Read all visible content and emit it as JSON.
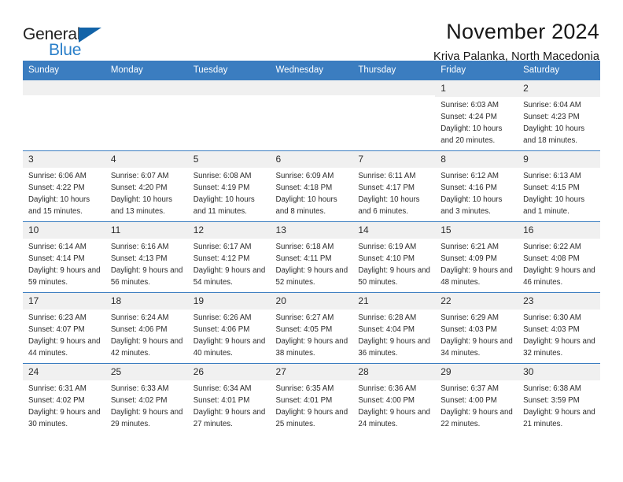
{
  "brand": {
    "name_part1": "General",
    "name_part2": "Blue",
    "triangle_color": "#1263a8",
    "blue_color": "#2a7fc9"
  },
  "header": {
    "title": "November 2024",
    "subtitle": "Kriva Palanka, North Macedonia"
  },
  "theme": {
    "header_bg": "#3b7dc0",
    "header_text": "#ffffff",
    "daynum_bg": "#f0f0f0",
    "cell_bg": "#ffffff",
    "grid_line": "#3b7dc0"
  },
  "calendar": {
    "weekday_headers": [
      "Sunday",
      "Monday",
      "Tuesday",
      "Wednesday",
      "Thursday",
      "Friday",
      "Saturday"
    ],
    "weeks": [
      [
        {
          "day": "",
          "blank": true,
          "sunrise": "",
          "sunset": "",
          "daylight": ""
        },
        {
          "day": "",
          "blank": true,
          "sunrise": "",
          "sunset": "",
          "daylight": ""
        },
        {
          "day": "",
          "blank": true,
          "sunrise": "",
          "sunset": "",
          "daylight": ""
        },
        {
          "day": "",
          "blank": true,
          "sunrise": "",
          "sunset": "",
          "daylight": ""
        },
        {
          "day": "",
          "blank": true,
          "sunrise": "",
          "sunset": "",
          "daylight": ""
        },
        {
          "day": "1",
          "blank": false,
          "sunrise": "Sunrise: 6:03 AM",
          "sunset": "Sunset: 4:24 PM",
          "daylight": "Daylight: 10 hours and 20 minutes."
        },
        {
          "day": "2",
          "blank": false,
          "sunrise": "Sunrise: 6:04 AM",
          "sunset": "Sunset: 4:23 PM",
          "daylight": "Daylight: 10 hours and 18 minutes."
        }
      ],
      [
        {
          "day": "3",
          "blank": false,
          "sunrise": "Sunrise: 6:06 AM",
          "sunset": "Sunset: 4:22 PM",
          "daylight": "Daylight: 10 hours and 15 minutes."
        },
        {
          "day": "4",
          "blank": false,
          "sunrise": "Sunrise: 6:07 AM",
          "sunset": "Sunset: 4:20 PM",
          "daylight": "Daylight: 10 hours and 13 minutes."
        },
        {
          "day": "5",
          "blank": false,
          "sunrise": "Sunrise: 6:08 AM",
          "sunset": "Sunset: 4:19 PM",
          "daylight": "Daylight: 10 hours and 11 minutes."
        },
        {
          "day": "6",
          "blank": false,
          "sunrise": "Sunrise: 6:09 AM",
          "sunset": "Sunset: 4:18 PM",
          "daylight": "Daylight: 10 hours and 8 minutes."
        },
        {
          "day": "7",
          "blank": false,
          "sunrise": "Sunrise: 6:11 AM",
          "sunset": "Sunset: 4:17 PM",
          "daylight": "Daylight: 10 hours and 6 minutes."
        },
        {
          "day": "8",
          "blank": false,
          "sunrise": "Sunrise: 6:12 AM",
          "sunset": "Sunset: 4:16 PM",
          "daylight": "Daylight: 10 hours and 3 minutes."
        },
        {
          "day": "9",
          "blank": false,
          "sunrise": "Sunrise: 6:13 AM",
          "sunset": "Sunset: 4:15 PM",
          "daylight": "Daylight: 10 hours and 1 minute."
        }
      ],
      [
        {
          "day": "10",
          "blank": false,
          "sunrise": "Sunrise: 6:14 AM",
          "sunset": "Sunset: 4:14 PM",
          "daylight": "Daylight: 9 hours and 59 minutes."
        },
        {
          "day": "11",
          "blank": false,
          "sunrise": "Sunrise: 6:16 AM",
          "sunset": "Sunset: 4:13 PM",
          "daylight": "Daylight: 9 hours and 56 minutes."
        },
        {
          "day": "12",
          "blank": false,
          "sunrise": "Sunrise: 6:17 AM",
          "sunset": "Sunset: 4:12 PM",
          "daylight": "Daylight: 9 hours and 54 minutes."
        },
        {
          "day": "13",
          "blank": false,
          "sunrise": "Sunrise: 6:18 AM",
          "sunset": "Sunset: 4:11 PM",
          "daylight": "Daylight: 9 hours and 52 minutes."
        },
        {
          "day": "14",
          "blank": false,
          "sunrise": "Sunrise: 6:19 AM",
          "sunset": "Sunset: 4:10 PM",
          "daylight": "Daylight: 9 hours and 50 minutes."
        },
        {
          "day": "15",
          "blank": false,
          "sunrise": "Sunrise: 6:21 AM",
          "sunset": "Sunset: 4:09 PM",
          "daylight": "Daylight: 9 hours and 48 minutes."
        },
        {
          "day": "16",
          "blank": false,
          "sunrise": "Sunrise: 6:22 AM",
          "sunset": "Sunset: 4:08 PM",
          "daylight": "Daylight: 9 hours and 46 minutes."
        }
      ],
      [
        {
          "day": "17",
          "blank": false,
          "sunrise": "Sunrise: 6:23 AM",
          "sunset": "Sunset: 4:07 PM",
          "daylight": "Daylight: 9 hours and 44 minutes."
        },
        {
          "day": "18",
          "blank": false,
          "sunrise": "Sunrise: 6:24 AM",
          "sunset": "Sunset: 4:06 PM",
          "daylight": "Daylight: 9 hours and 42 minutes."
        },
        {
          "day": "19",
          "blank": false,
          "sunrise": "Sunrise: 6:26 AM",
          "sunset": "Sunset: 4:06 PM",
          "daylight": "Daylight: 9 hours and 40 minutes."
        },
        {
          "day": "20",
          "blank": false,
          "sunrise": "Sunrise: 6:27 AM",
          "sunset": "Sunset: 4:05 PM",
          "daylight": "Daylight: 9 hours and 38 minutes."
        },
        {
          "day": "21",
          "blank": false,
          "sunrise": "Sunrise: 6:28 AM",
          "sunset": "Sunset: 4:04 PM",
          "daylight": "Daylight: 9 hours and 36 minutes."
        },
        {
          "day": "22",
          "blank": false,
          "sunrise": "Sunrise: 6:29 AM",
          "sunset": "Sunset: 4:03 PM",
          "daylight": "Daylight: 9 hours and 34 minutes."
        },
        {
          "day": "23",
          "blank": false,
          "sunrise": "Sunrise: 6:30 AM",
          "sunset": "Sunset: 4:03 PM",
          "daylight": "Daylight: 9 hours and 32 minutes."
        }
      ],
      [
        {
          "day": "24",
          "blank": false,
          "sunrise": "Sunrise: 6:31 AM",
          "sunset": "Sunset: 4:02 PM",
          "daylight": "Daylight: 9 hours and 30 minutes."
        },
        {
          "day": "25",
          "blank": false,
          "sunrise": "Sunrise: 6:33 AM",
          "sunset": "Sunset: 4:02 PM",
          "daylight": "Daylight: 9 hours and 29 minutes."
        },
        {
          "day": "26",
          "blank": false,
          "sunrise": "Sunrise: 6:34 AM",
          "sunset": "Sunset: 4:01 PM",
          "daylight": "Daylight: 9 hours and 27 minutes."
        },
        {
          "day": "27",
          "blank": false,
          "sunrise": "Sunrise: 6:35 AM",
          "sunset": "Sunset: 4:01 PM",
          "daylight": "Daylight: 9 hours and 25 minutes."
        },
        {
          "day": "28",
          "blank": false,
          "sunrise": "Sunrise: 6:36 AM",
          "sunset": "Sunset: 4:00 PM",
          "daylight": "Daylight: 9 hours and 24 minutes."
        },
        {
          "day": "29",
          "blank": false,
          "sunrise": "Sunrise: 6:37 AM",
          "sunset": "Sunset: 4:00 PM",
          "daylight": "Daylight: 9 hours and 22 minutes."
        },
        {
          "day": "30",
          "blank": false,
          "sunrise": "Sunrise: 6:38 AM",
          "sunset": "Sunset: 3:59 PM",
          "daylight": "Daylight: 9 hours and 21 minutes."
        }
      ]
    ]
  }
}
